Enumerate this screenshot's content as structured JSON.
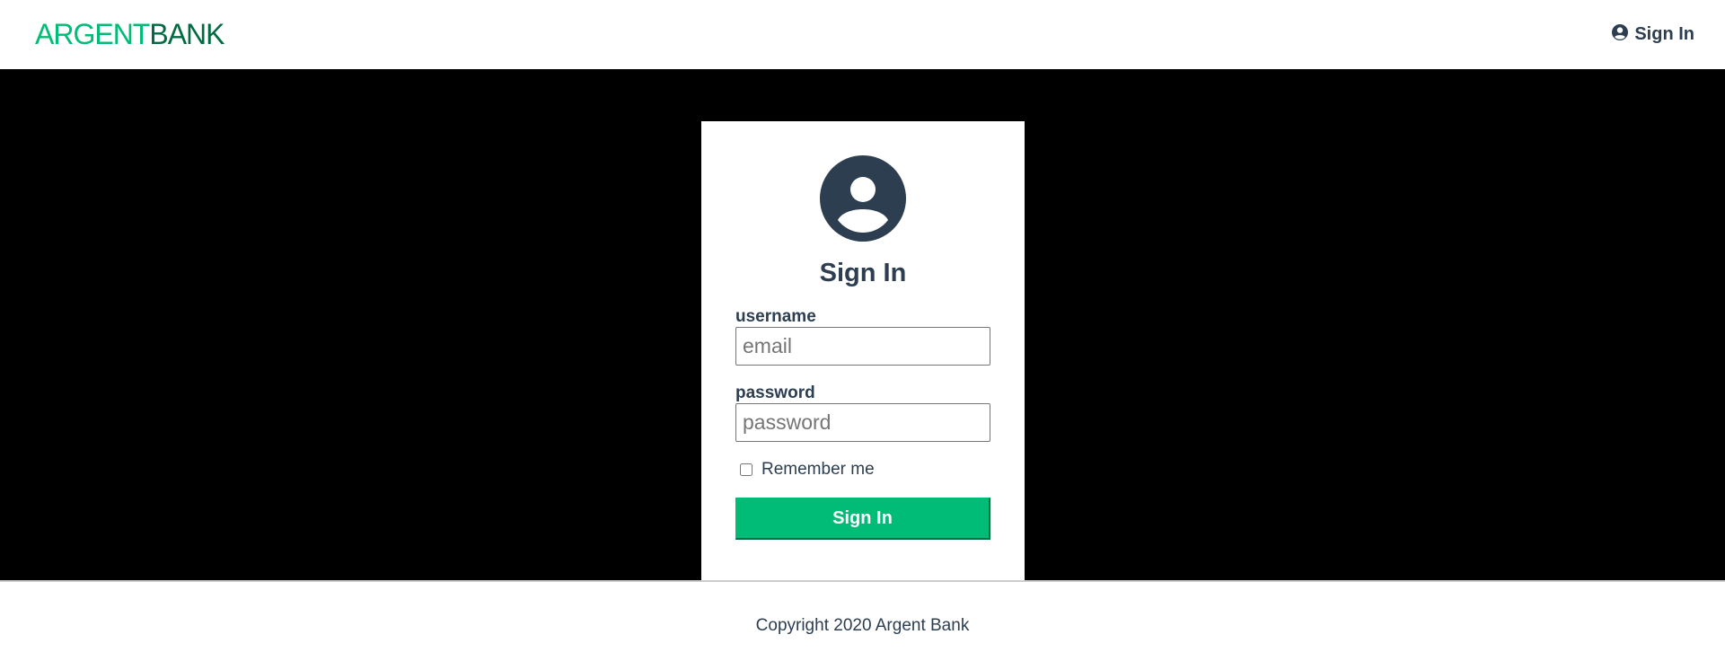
{
  "header": {
    "logo_part1": "ARGENT",
    "logo_part2": "BANK",
    "signin_label": "Sign In",
    "signin_icon": "user-circle-icon"
  },
  "signin_card": {
    "icon": "user-circle-icon",
    "title": "Sign In",
    "username_label": "username",
    "username_placeholder": "email",
    "password_label": "password",
    "password_placeholder": "password",
    "remember_label": "Remember me",
    "remember_checked": false,
    "submit_label": "Sign In"
  },
  "footer": {
    "copyright": "Copyright 2020 Argent Bank"
  },
  "colors": {
    "brand_green": "#00bc77",
    "brand_dark_green": "#006b43",
    "text_dark": "#2c3e50",
    "background_main": "#000000"
  }
}
